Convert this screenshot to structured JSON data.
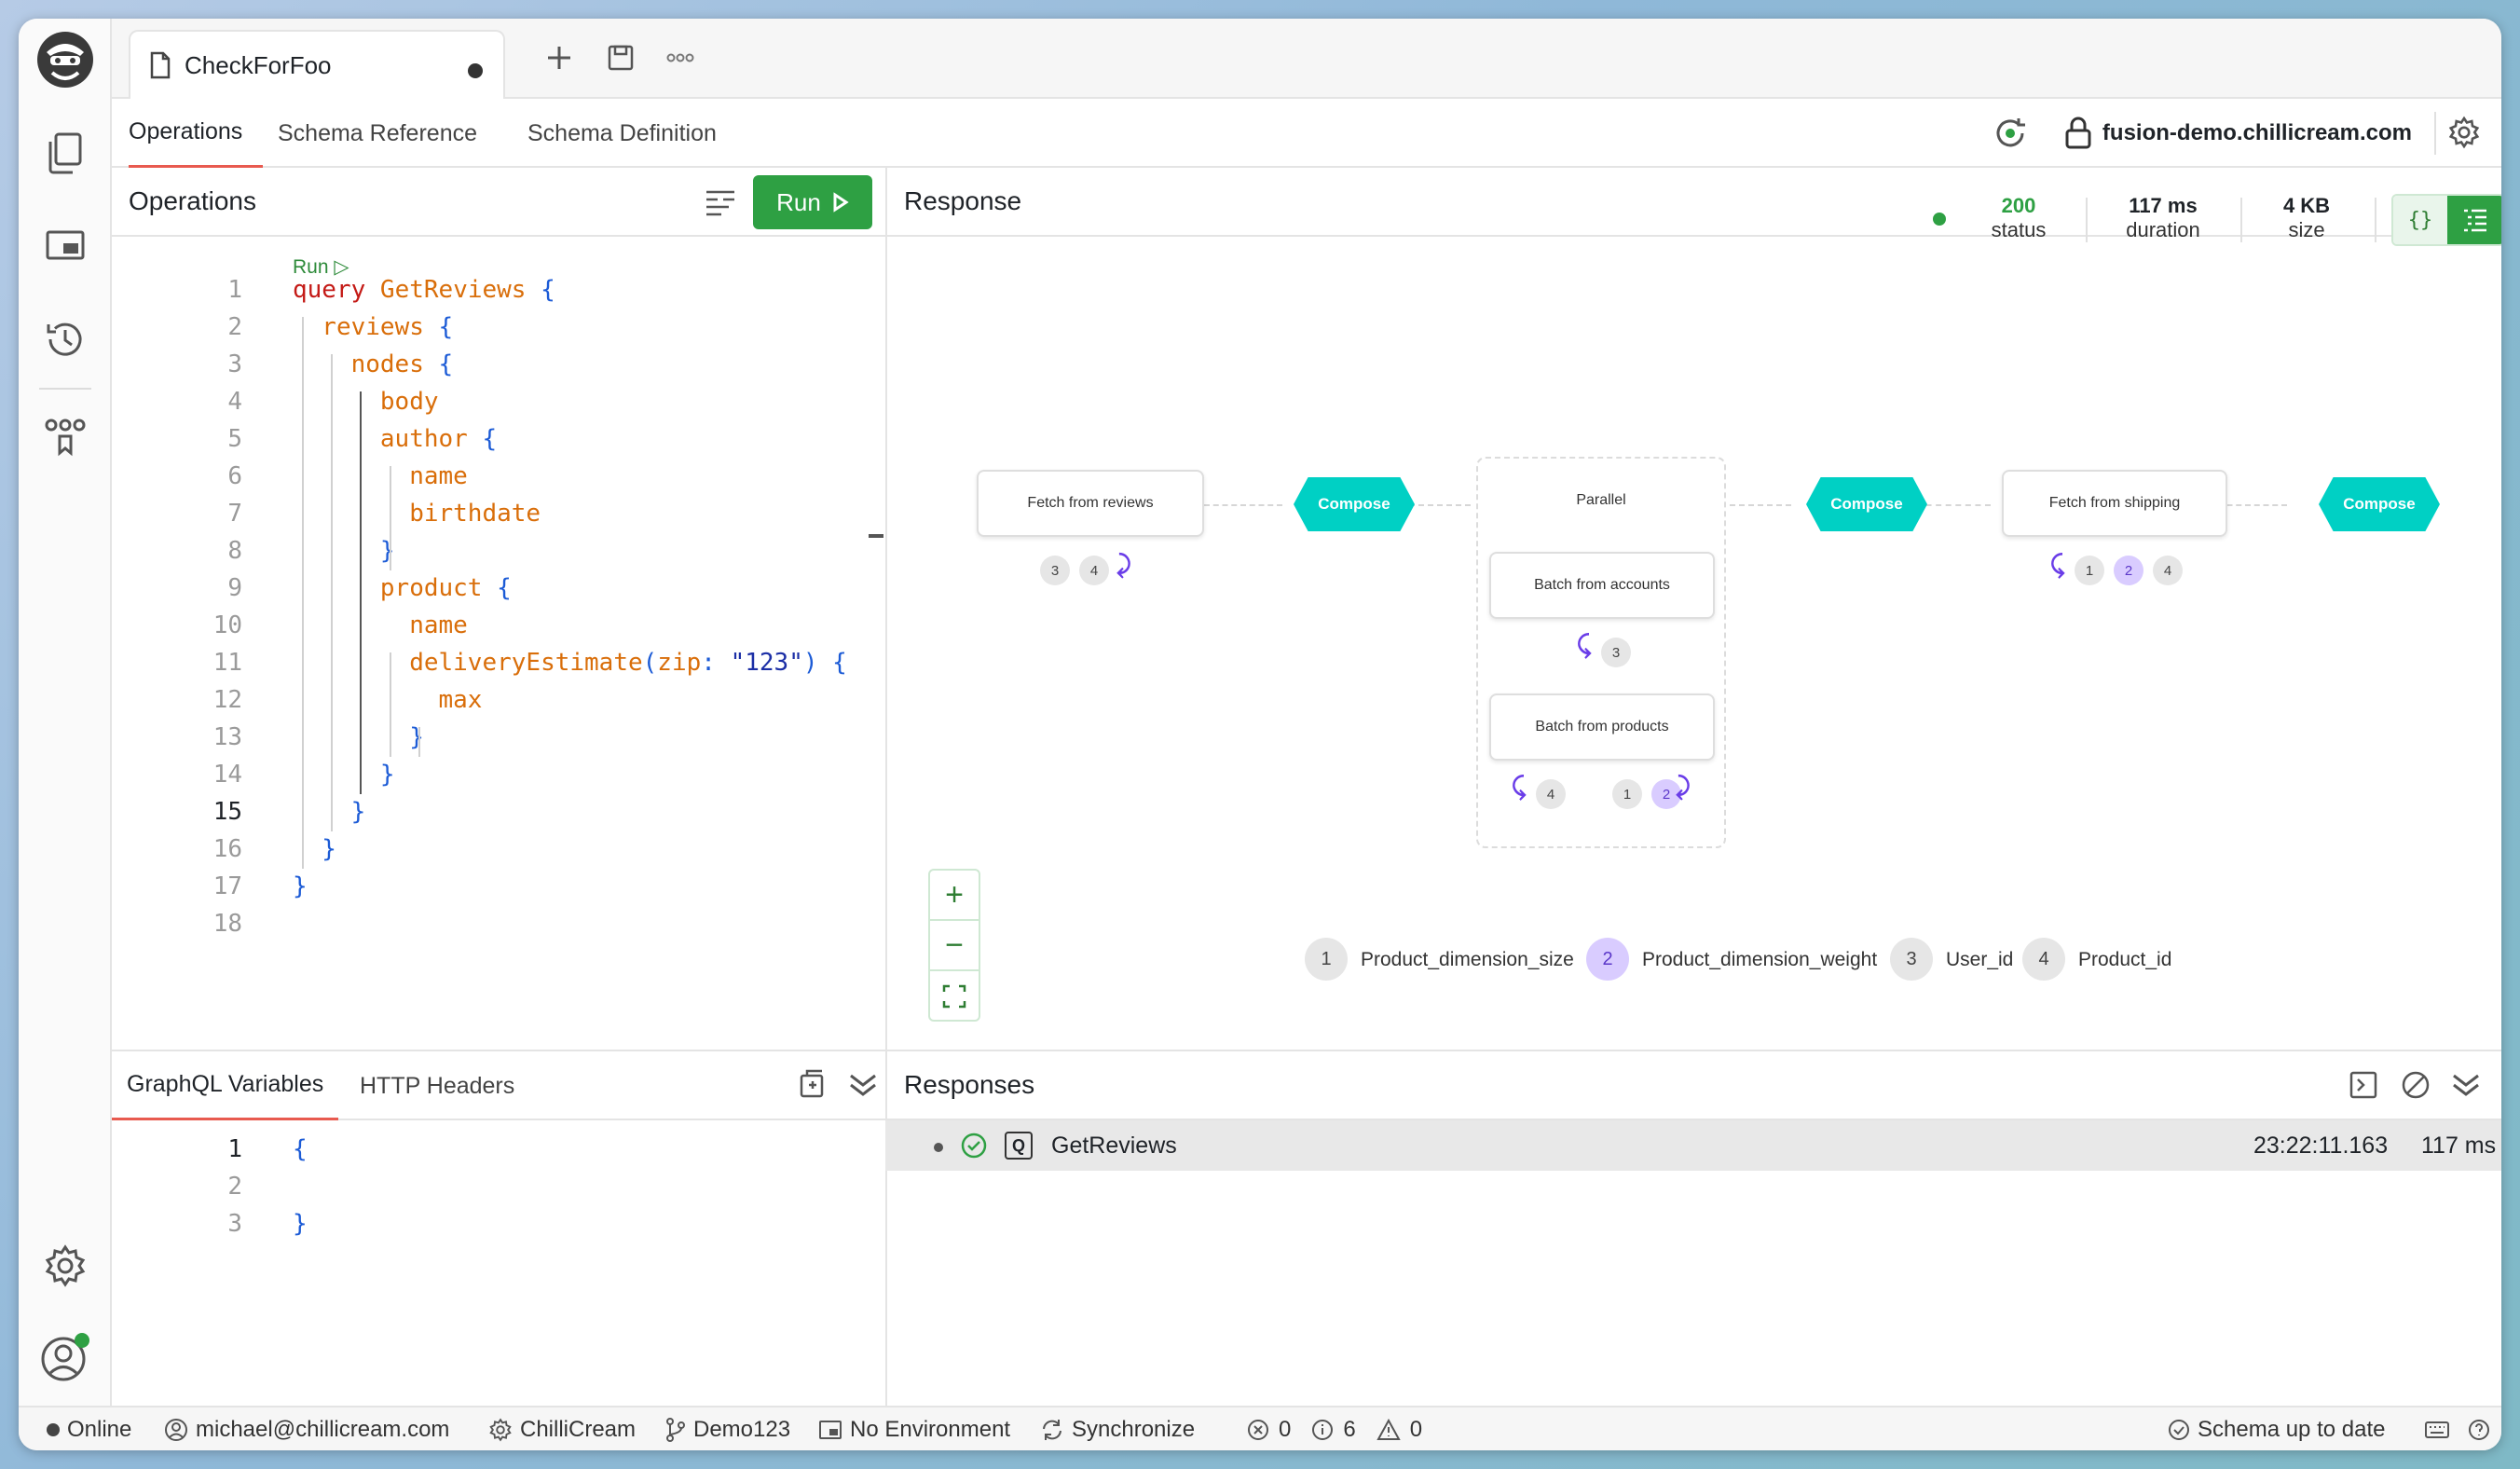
{
  "tab": {
    "name": "CheckForFoo"
  },
  "nav": {
    "tabs": [
      "Operations",
      "Schema Reference",
      "Schema Definition"
    ],
    "server": "fusion-demo.chillicream.com"
  },
  "operations": {
    "title": "Operations",
    "run_label": "Run",
    "codelens": "Run ▷",
    "lines": [
      [
        [
          "kw",
          "query "
        ],
        [
          "op",
          "GetReviews "
        ],
        [
          "br",
          "{"
        ]
      ],
      [
        [
          "fd",
          "reviews "
        ],
        [
          "br",
          "{"
        ]
      ],
      [
        [
          "fd",
          "nodes "
        ],
        [
          "br",
          "{"
        ]
      ],
      [
        [
          "fd",
          "body"
        ]
      ],
      [
        [
          "fd",
          "author "
        ],
        [
          "br",
          "{"
        ]
      ],
      [
        [
          "fd",
          "name"
        ]
      ],
      [
        [
          "fd",
          "birthdate"
        ]
      ],
      [
        [
          "br",
          "}"
        ]
      ],
      [
        [
          "fd",
          "product "
        ],
        [
          "br",
          "{"
        ]
      ],
      [
        [
          "fd",
          "name"
        ]
      ],
      [
        [
          "fd",
          "deliveryEstimate"
        ],
        [
          "br",
          "("
        ],
        [
          "fd",
          "zip"
        ],
        [
          "br",
          ": "
        ],
        [
          "st",
          "\"123\""
        ],
        [
          "br",
          ") {"
        ]
      ],
      [
        [
          "fd",
          "max"
        ]
      ],
      [
        [
          "br",
          "}"
        ]
      ],
      [
        [
          "br",
          "}"
        ]
      ],
      [
        [
          "br",
          "}"
        ]
      ],
      [
        [
          "br",
          "}"
        ]
      ],
      [
        [
          "br",
          "}"
        ]
      ],
      []
    ],
    "current_line": 15
  },
  "variables": {
    "tabs": [
      "GraphQL Variables",
      "HTTP Headers"
    ],
    "lines": [
      "{",
      "",
      "}"
    ]
  },
  "response": {
    "title": "Response",
    "status": {
      "value": "200",
      "label": "status"
    },
    "duration": {
      "value": "117 ms",
      "label": "duration"
    },
    "size": {
      "value": "4 KB",
      "label": "size"
    },
    "view_icon": "{}"
  },
  "plan": {
    "nodes": {
      "fetch_reviews": "Fetch from reviews",
      "compose": "Compose",
      "parallel": "Parallel",
      "batch_accounts": "Batch from accounts",
      "batch_products": "Batch from products",
      "fetch_shipping": "Fetch from shipping"
    },
    "chips": {
      "fetch_reviews": [
        "3",
        "4"
      ],
      "batch_accounts": [
        "3"
      ],
      "batch_products_a": [
        "4"
      ],
      "batch_products_b": [
        "1",
        "2"
      ],
      "fetch_shipping": [
        "1",
        "2",
        "4"
      ]
    },
    "legend": [
      {
        "id": "1",
        "label": "Product_dimension_size"
      },
      {
        "id": "2",
        "label": "Product_dimension_weight"
      },
      {
        "id": "3",
        "label": "User_id"
      },
      {
        "id": "4",
        "label": "Product_id"
      }
    ]
  },
  "responses": {
    "title": "Responses",
    "items": [
      {
        "type": "Q",
        "name": "GetReviews",
        "time": "23:22:11.163",
        "duration": "117 ms"
      }
    ]
  },
  "statusbar": {
    "online": "Online",
    "user": "michael@chillicream.com",
    "org": "ChilliCream",
    "workspace": "Demo123",
    "environment": "No Environment",
    "sync": "Synchronize",
    "errors": "0",
    "infos": "6",
    "warnings": "0",
    "schema": "Schema up to date"
  },
  "colors": {
    "accent": "#2ea043",
    "compose": "#00d0c4",
    "active_tab_underline": "#e85a4f",
    "chip_highlight": "#d9ccff"
  }
}
